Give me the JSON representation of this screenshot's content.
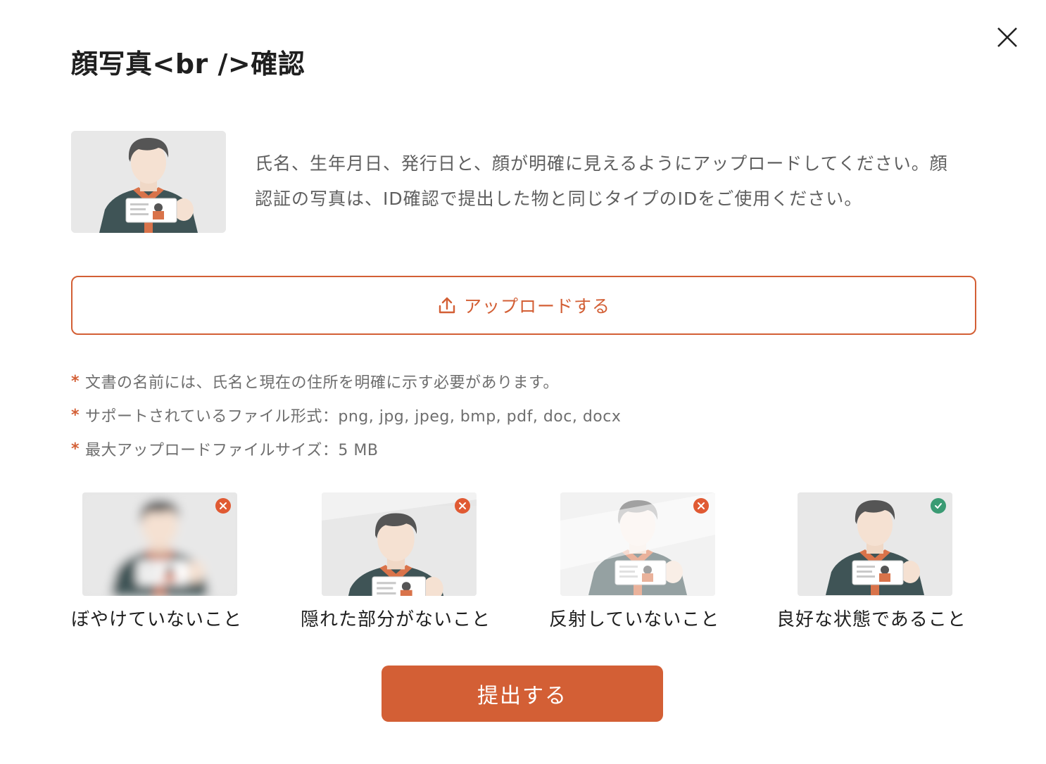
{
  "dialog": {
    "title": "顔写真<br />確認",
    "close_icon": "close-icon",
    "description": "氏名、生年月日、発行日と、顔が明確に見えるようにアップロードしてください。顔認証の写真は、ID確認で提出した物と同じタイプのIDをご使用ください。",
    "upload": {
      "label": "アップロードする",
      "icon": "upload-icon"
    },
    "notes": [
      {
        "mark": "*",
        "text": "文書の名前には、氏名と現在の住所を明確に示す必要があります。"
      },
      {
        "mark": "*",
        "text": "サポートされているファイル形式：png, jpg, jpeg, bmp, pdf, doc, docx"
      },
      {
        "mark": "*",
        "text": "最大アップロードファイルサイズ：5 MB"
      }
    ],
    "examples": [
      {
        "label": "ぼやけていないこと",
        "status": "bad",
        "icon": "x-icon"
      },
      {
        "label": "隠れた部分がないこと",
        "status": "bad",
        "icon": "x-icon"
      },
      {
        "label": "反射していないこと",
        "status": "bad",
        "icon": "x-icon"
      },
      {
        "label": "良好な状態であること",
        "status": "good",
        "icon": "check-icon"
      }
    ],
    "submit_label": "提出する"
  },
  "colors": {
    "accent": "#d35f35",
    "bad": "#e05a33",
    "good": "#3b9b74",
    "muted_text": "#6e6e6e"
  }
}
